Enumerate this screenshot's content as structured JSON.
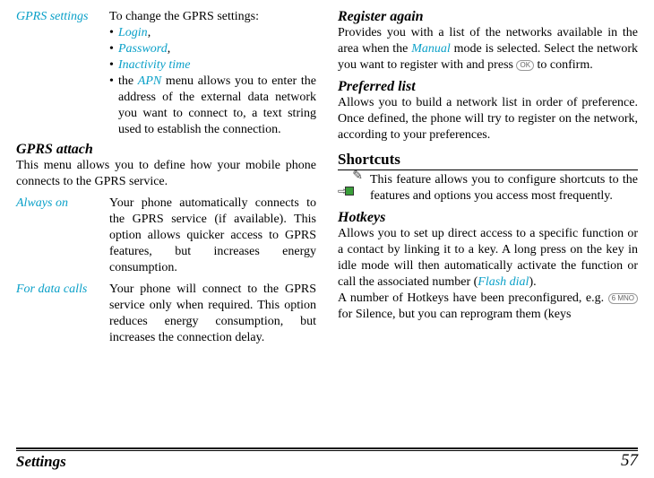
{
  "left": {
    "gprs_settings": {
      "term": "GPRS settings",
      "intro": "To change the GPRS settings:",
      "items": {
        "login": "Login",
        "password": "Password",
        "inactivity": "Inactivity time",
        "apn_pre": "the ",
        "apn_word": "APN",
        "apn_post": " menu allows you to enter the address of the external data network you want to connect to, a text string used to establish the connection."
      }
    },
    "gprs_attach": {
      "heading": "GPRS attach",
      "blurb": "This menu allows you to define how your mobile phone connects to the GPRS service.",
      "always_on": {
        "term": "Always on",
        "desc": "Your phone automatically connects to the GPRS service (if available). This option allows quicker access to GPRS features, but increases energy consumption."
      },
      "for_data": {
        "term": "For data calls",
        "desc": "Your phone will connect to the GPRS service only when required. This option reduces energy consumption, but increases the connection delay."
      }
    }
  },
  "right": {
    "register": {
      "heading": "Register again",
      "p1a": "Provides you with a list of the networks available in the area when the ",
      "manual": "Manual",
      "p1b": " mode is selected. Select the network you want to register with and press ",
      "p1c": " to confirm.",
      "ok_key": "OK"
    },
    "preferred": {
      "heading": "Preferred list",
      "p": "Allows you to build a network list in order of preference. Once defined, the phone will try to register on the network, according to your preferences."
    },
    "shortcuts": {
      "heading": "Shortcuts",
      "tip": "This feature allows you to configure shortcuts to the features and options you access most frequently."
    },
    "hotkeys": {
      "heading": "Hotkeys",
      "p1a": "Allows you to set up direct access to a specific function or a contact by linking it to a key. A long press on the key in idle mode will then automatically activate the function or call the associated number (",
      "flash": "Flash dial",
      "p1b": ").",
      "p2a": "A number of Hotkeys have been preconfigured, e.g. ",
      "key6": "6 MNO",
      "p2b": " for Silence, but you can reprogram them (keys"
    }
  },
  "footer": {
    "left": "Settings",
    "right": "57"
  }
}
